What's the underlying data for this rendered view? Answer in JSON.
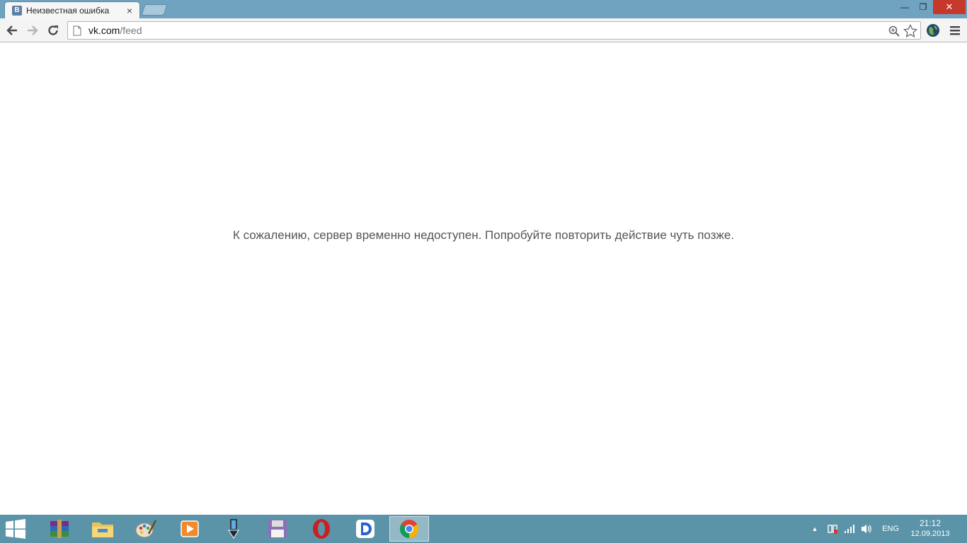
{
  "window": {
    "tab_title": "Неизвестная ошибка",
    "tab_favicon_letter": "В",
    "tab_close": "×",
    "controls": {
      "minimize": "—",
      "maximize": "❐",
      "close": "✕"
    }
  },
  "toolbar": {
    "url_host": "vk.com",
    "url_path": "/feed",
    "icons": [
      "back-arrow-icon",
      "forward-arrow-icon",
      "reload-icon",
      "page-icon",
      "zoom-icon",
      "bookmark-star-icon",
      "extension-globe-icon",
      "menu-icon"
    ]
  },
  "page": {
    "error_message": "К сожалению, сервер временно недоступен. Попробуйте повторить действие чуть позже."
  },
  "taskbar": {
    "apps": [
      "winrar-icon",
      "file-explorer-icon",
      "paint-icon",
      "media-player-icon",
      "pen-tool-icon",
      "floppy-disk-icon",
      "opera-icon",
      "dropbox-like-icon",
      "chrome-icon"
    ],
    "active_app": "chrome-icon",
    "language": "ENG",
    "time": "21:12",
    "date": "12.09.2013",
    "colors": {
      "taskbar": "#5b94a8",
      "titlebar": "#6fa3c0"
    }
  }
}
